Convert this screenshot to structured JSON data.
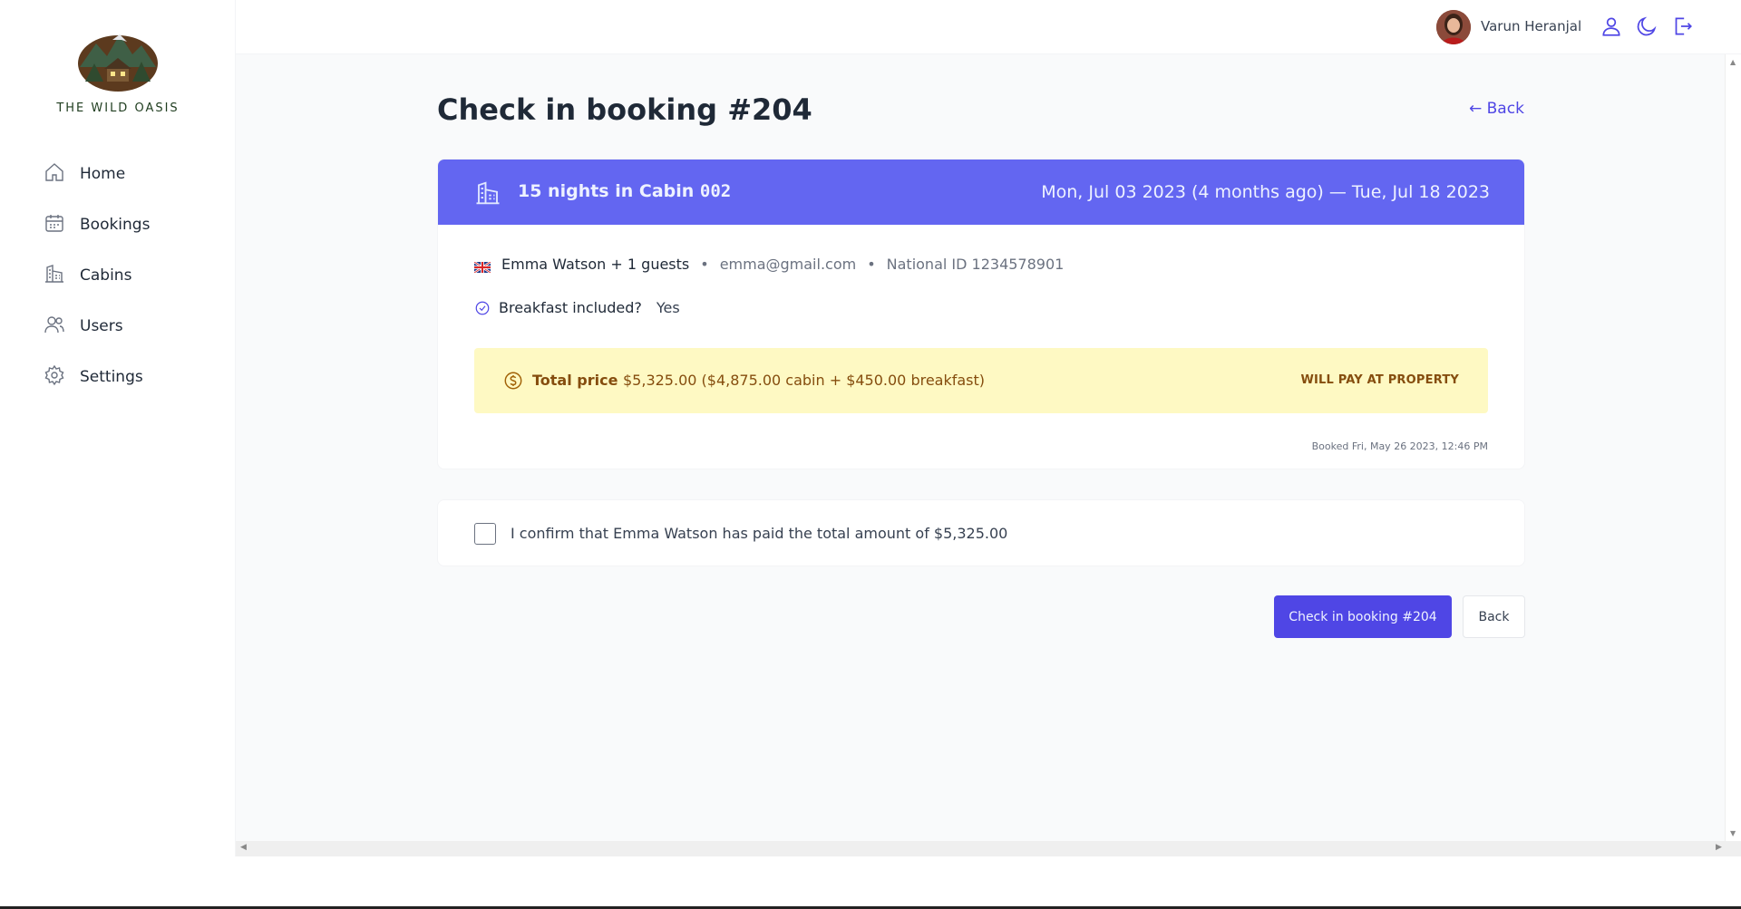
{
  "app": {
    "logo_text": "THE WILD OASIS"
  },
  "sidebar": {
    "items": [
      {
        "label": "Home",
        "icon": "home-icon"
      },
      {
        "label": "Bookings",
        "icon": "calendar-icon"
      },
      {
        "label": "Cabins",
        "icon": "cabin-icon"
      },
      {
        "label": "Users",
        "icon": "users-icon"
      },
      {
        "label": "Settings",
        "icon": "gear-icon"
      }
    ]
  },
  "header": {
    "user_name": "Varun Heranjal",
    "icons": [
      "user-icon",
      "moon-icon",
      "logout-icon"
    ]
  },
  "page": {
    "title": "Check in booking #204",
    "back_link": "← Back"
  },
  "booking": {
    "nights_text": "15 nights in Cabin",
    "cabin_number": "002",
    "dates": "Mon, Jul 03 2023 (4 months ago) — Tue, Jul 18 2023",
    "guest": "Emma Watson + 1 guests",
    "email": "emma@gmail.com",
    "national_id": "National ID 1234578901",
    "separator": "•",
    "breakfast_label": "Breakfast included?",
    "breakfast_value": "Yes",
    "price_label": "Total price",
    "price_value": "$5,325.00 ($4,875.00 cabin + $450.00 breakfast)",
    "pay_status": "WILL PAY AT PROPERTY",
    "booked_on": "Booked Fri, May 26 2023, 12:46 PM"
  },
  "confirm": {
    "label": "I confirm that Emma Watson has paid the total amount of $5,325.00"
  },
  "actions": {
    "checkin_label": "Check in booking #204",
    "back_label": "Back"
  },
  "colors": {
    "brand": "#4f46e5",
    "header_band": "#6366f1",
    "price_bg": "#fef9c3",
    "price_text": "#854d0e"
  }
}
